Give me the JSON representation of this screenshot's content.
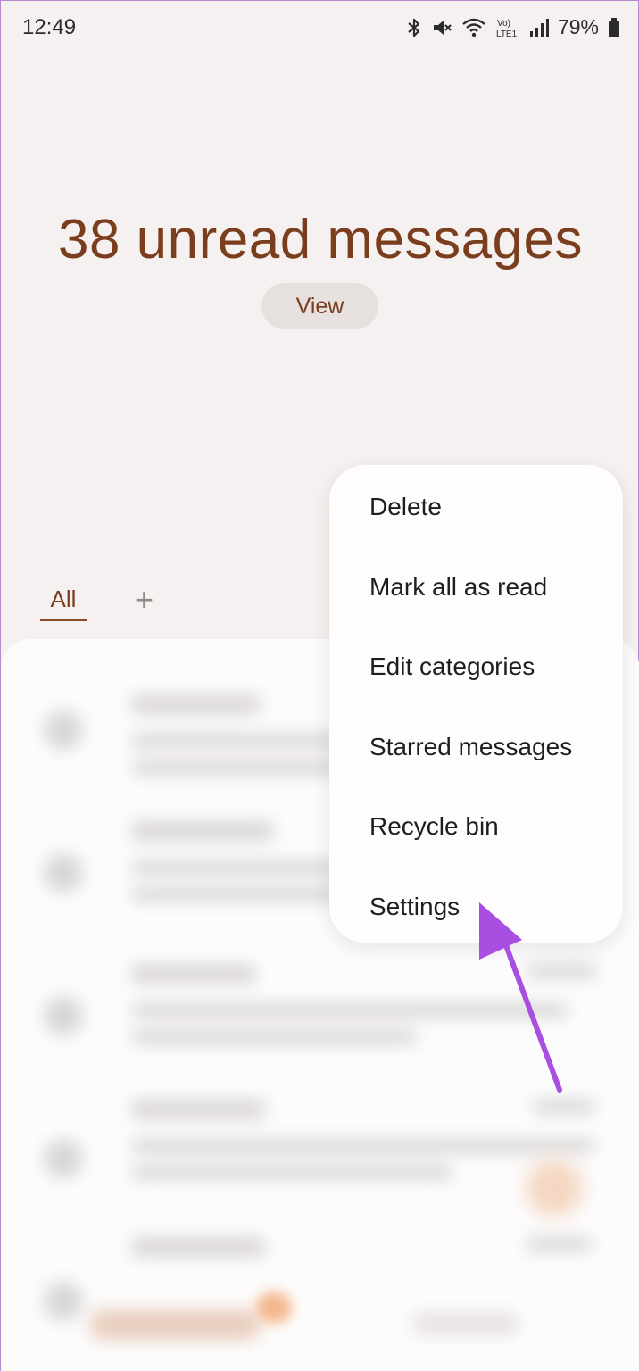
{
  "status_bar": {
    "time": "12:49",
    "battery": "79%",
    "icons": [
      "bluetooth-icon",
      "mute-icon",
      "wifi-icon",
      "volte-icon",
      "signal-icon",
      "battery-icon"
    ],
    "volte_label": "Vo) LTE1"
  },
  "hero": {
    "title": "38 unread messages",
    "view_label": "View"
  },
  "tabs": {
    "all_label": "All",
    "add_label": "+"
  },
  "menu": {
    "items": [
      {
        "label": "Delete"
      },
      {
        "label": "Mark all as read"
      },
      {
        "label": "Edit categories"
      },
      {
        "label": "Starred messages"
      },
      {
        "label": "Recycle bin"
      },
      {
        "label": "Settings"
      }
    ]
  },
  "colors": {
    "accent": "#7a3d1d",
    "background": "#f5f1f0",
    "arrow": "#a84ee0"
  }
}
